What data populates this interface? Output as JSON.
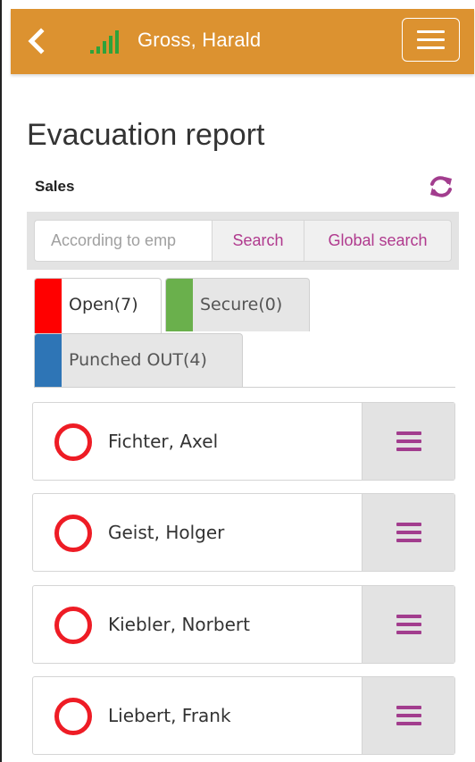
{
  "header": {
    "user_name": "Gross, Harald",
    "colors": {
      "background": "#dc9230",
      "signal": "#2fa23a"
    },
    "icons": {
      "back": "chevron-left-icon",
      "signal": "signal-strength-icon",
      "menu": "hamburger-menu-icon"
    }
  },
  "page": {
    "title": "Evacuation report",
    "section": "Sales"
  },
  "search": {
    "placeholder": "According to emp",
    "search_label": "Search",
    "global_label": "Global search"
  },
  "tabs": [
    {
      "label": "Open(7)",
      "color": "#ff0000",
      "active": true
    },
    {
      "label": "Secure(0)",
      "color": "#6ab04c",
      "active": false
    },
    {
      "label": "Punched OUT(4)",
      "color": "#2e75b6",
      "active": false
    }
  ],
  "employees": [
    {
      "name": "Fichter, Axel"
    },
    {
      "name": "Geist, Holger"
    },
    {
      "name": "Kiebler, Norbert"
    },
    {
      "name": "Liebert, Frank"
    }
  ],
  "colors": {
    "accent": "#b03a8e",
    "status_open": "#ee1c25"
  }
}
